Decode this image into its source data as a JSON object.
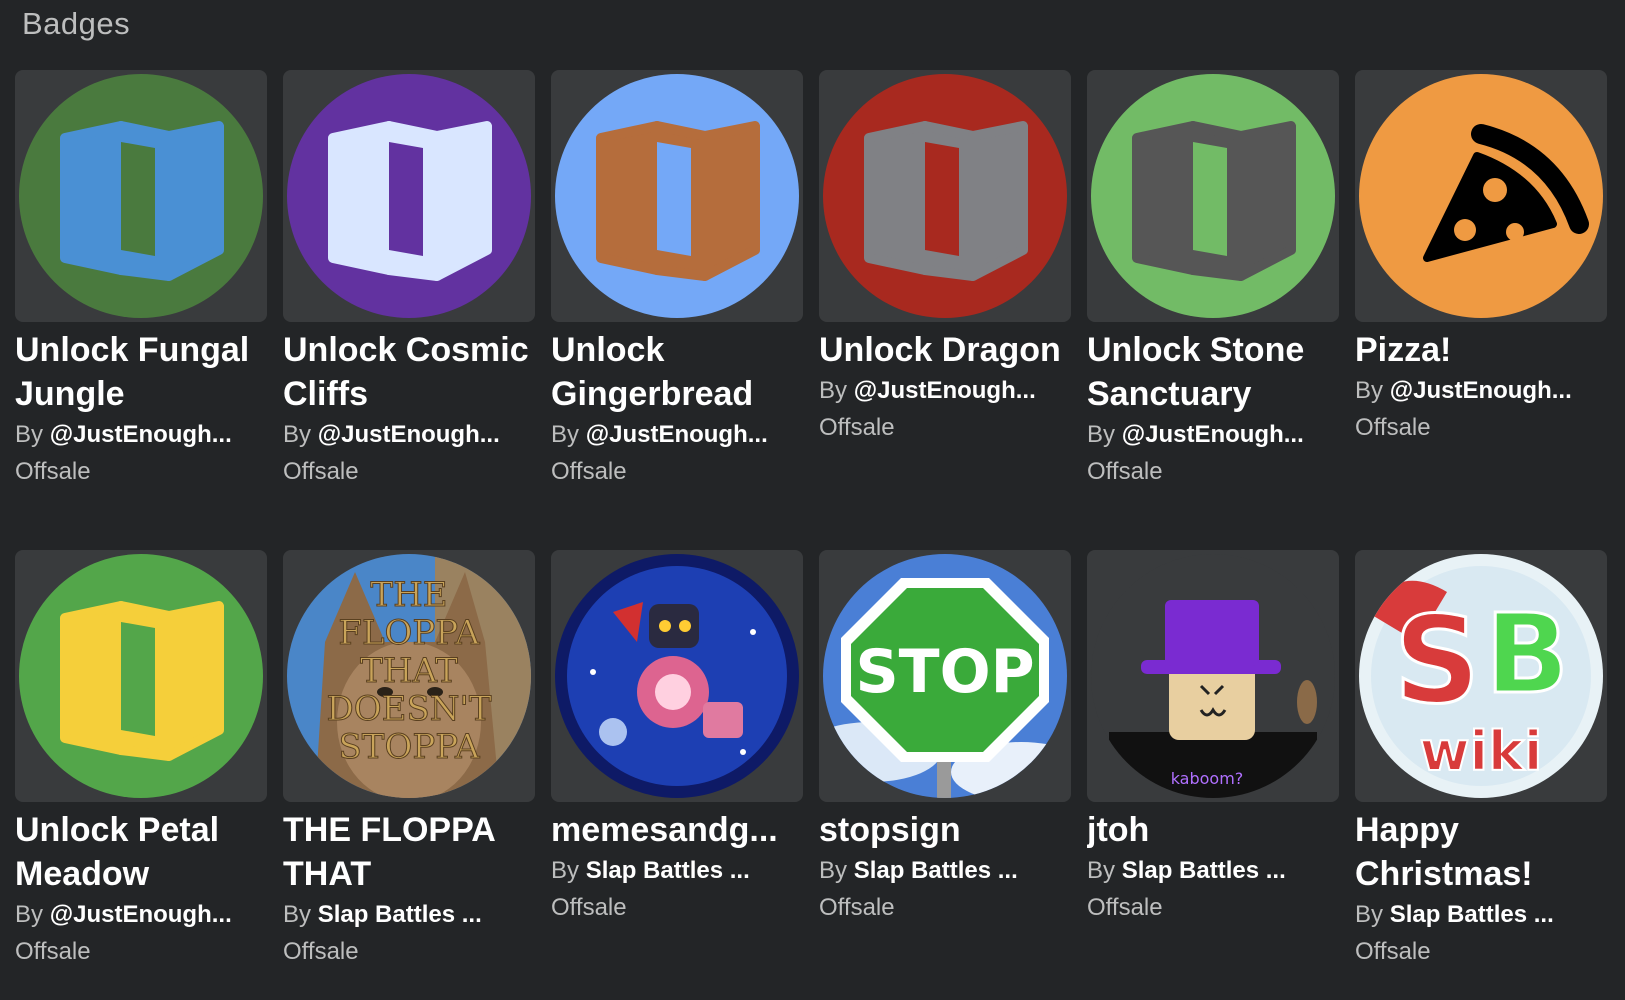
{
  "section": {
    "title": "Badges"
  },
  "badges": [
    {
      "name": "Unlock Fungal Jungle",
      "by": "By",
      "creator": "@JustEnough...",
      "price": "Offsale",
      "icon": "map-icon",
      "bg": "#4a7a3e",
      "fg": "#4a90d4",
      "panel": "#4a7a3e"
    },
    {
      "name": "Unlock Cosmic Cliffs",
      "by": "By",
      "creator": "@JustEnough...",
      "price": "Offsale",
      "icon": "map-icon",
      "bg": "#6232a0",
      "fg": "#d9e6ff",
      "panel": "#6232a0"
    },
    {
      "name": "Unlock Gingerbread",
      "by": "By",
      "creator": "@JustEnough...",
      "price": "Offsale",
      "icon": "map-icon",
      "bg": "#74a8f7",
      "fg": "#b56d3c",
      "panel": "#74a8f7"
    },
    {
      "name": "Unlock Dragon",
      "by": "By",
      "creator": "@JustEnough...",
      "price": "Offsale",
      "icon": "map-icon",
      "bg": "#a8291f",
      "fg": "#808185",
      "panel": "#a8291f"
    },
    {
      "name": "Unlock Stone Sanctuary",
      "by": "By",
      "creator": "@JustEnough...",
      "price": "Offsale",
      "icon": "map-icon",
      "bg": "#72bb66",
      "fg": "#565656",
      "panel": "#72bb66"
    },
    {
      "name": "Pizza!",
      "by": "By",
      "creator": "@JustEnough...",
      "price": "Offsale",
      "icon": "pizza-icon",
      "bg": "#ef9a42",
      "fg": "#000000",
      "panel": "#ef9a42"
    },
    {
      "name": "Unlock Petal Meadow",
      "by": "By",
      "creator": "@JustEnough...",
      "price": "Offsale",
      "icon": "map-icon",
      "bg": "#53a64a",
      "fg": "#f5cf3a",
      "panel": "#53a64a"
    },
    {
      "name": "THE FLOPPA THAT",
      "by": "By",
      "creator": "Slap Battles ...",
      "price": "Offsale",
      "icon": "floppa-image",
      "bg": "#6a5036",
      "fg": "#c9a45a",
      "panel": "",
      "caption_lines": [
        "THE",
        "FLOPPA",
        "THAT",
        "DOESN'T",
        "STOPPA"
      ]
    },
    {
      "name": "memesandg...",
      "by": "By",
      "creator": "Slap Battles ...",
      "price": "Offsale",
      "icon": "robot-fighter-image",
      "bg": "#1d3fb3",
      "fg": "#cfe3ff",
      "panel": ""
    },
    {
      "name": "stopsign",
      "by": "By",
      "creator": "Slap Battles ...",
      "price": "Offsale",
      "icon": "stop-sign-image",
      "bg": "#4a7fd6",
      "fg": "#3aaa3a",
      "panel": "",
      "sign_text": "STOP"
    },
    {
      "name": "jtoh",
      "by": "By",
      "creator": "Slap Battles ...",
      "price": "Offsale",
      "icon": "roblox-avatar-image",
      "bg": "#393b3d",
      "fg": "#7a2bd1",
      "panel": "",
      "caption": "kaboom?"
    },
    {
      "name": "Happy Christmas!",
      "by": "By",
      "creator": "Slap Battles ...",
      "price": "Offsale",
      "icon": "sb-wiki-logo",
      "bg": "#e8f2f6",
      "fg": "#d83b3b",
      "panel": "",
      "logo_letters": "SB",
      "logo_word": "wiki"
    }
  ]
}
